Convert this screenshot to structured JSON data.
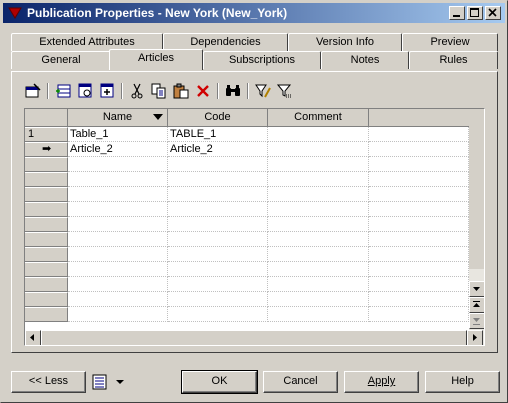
{
  "window": {
    "title": "Publication Properties - New York (New_York)",
    "icons": {
      "app": "publication-icon",
      "minimize": "minimize-icon",
      "maximize": "maximize-icon",
      "close": "close-icon"
    }
  },
  "tabs": {
    "row_back": [
      "Extended Attributes",
      "Dependencies",
      "Version Info",
      "Preview"
    ],
    "row_front": [
      "General",
      "Articles",
      "Subscriptions",
      "Notes",
      "Rules"
    ],
    "active": "Articles"
  },
  "toolbar": {
    "tools": [
      "properties-icon",
      "add-row-icon",
      "insert-row-icon",
      "add-objects-icon",
      "cut-icon",
      "copy-icon",
      "paste-icon",
      "delete-icon",
      "find-icon",
      "customize-columns-icon",
      "filter-icon"
    ]
  },
  "grid": {
    "columns": [
      "Name",
      "Code",
      "Comment"
    ],
    "rows": [
      {
        "marker": "1",
        "name": "Table_1",
        "code": "TABLE_1",
        "comment": ""
      },
      {
        "marker": "➡",
        "name": "Article_2",
        "code": "Article_2",
        "comment": ""
      }
    ],
    "empty_rows": 12
  },
  "footer": {
    "less_label": "<< Less",
    "ok_label": "OK",
    "cancel_label": "Cancel",
    "apply_label": "Apply",
    "help_label": "Help",
    "apply_mnemonic": "A"
  },
  "colors": {
    "titlebar_start": "#0a246a",
    "titlebar_end": "#a6caf0",
    "face": "#d4d0c8"
  }
}
